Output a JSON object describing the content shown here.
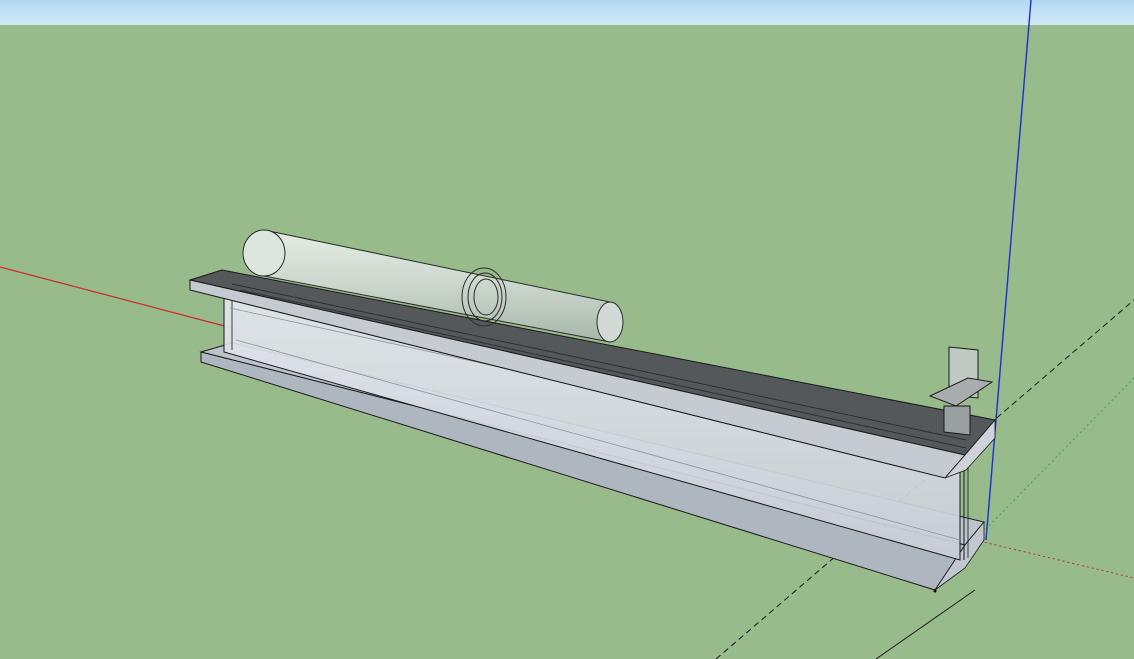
{
  "app": {
    "type": "3D modeling viewport"
  },
  "scene": {
    "colors": {
      "sky_top": "#b9dcf3",
      "sky_bottom": "#cfe8f8",
      "ground": "#98bb8c",
      "axis_red": "#cc2a2a",
      "axis_green": "#3fa13f",
      "axis_blue": "#1d2fd1",
      "edge": "#1a1a1a",
      "flange_top": "#55585a",
      "flange_front": "#c3c9cf",
      "web": "#d9dde6",
      "pipe": "#cfd8d2",
      "bottom_flange": "#b7bec6"
    },
    "objects": [
      "i-beam",
      "pipe",
      "pipe-ring",
      "bracket"
    ]
  }
}
